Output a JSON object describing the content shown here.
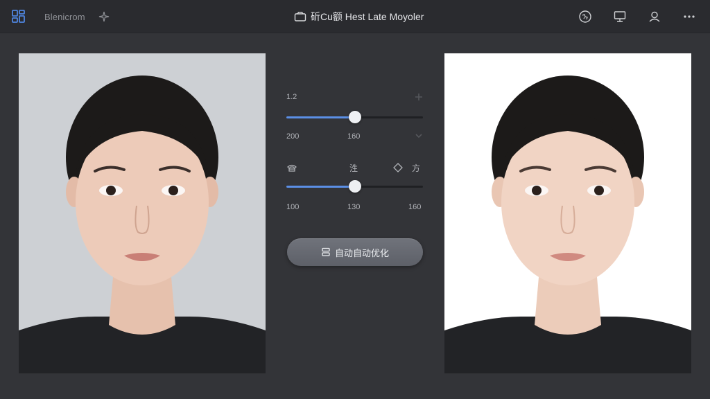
{
  "topbar": {
    "app_name": "Blenicrom",
    "title": "斫Cu额 Hest Late Moyoler",
    "icons": [
      "grid-icon",
      "sparkle-icon",
      "camera-icon",
      "globe-icon",
      "monitor-icon",
      "user-icon",
      "more-icon"
    ]
  },
  "controls": {
    "label_top": "1.2",
    "slider1": {
      "value": 0.5,
      "min_label": "200",
      "mid_label": "160"
    },
    "row2": {
      "mid_label": "泩",
      "right_label": "方"
    },
    "slider2": {
      "value": 0.5,
      "min_label": "100",
      "mid_label": "130",
      "max_label": "160"
    },
    "auto_button_label": "自动自动优化"
  },
  "colors": {
    "accent": "#5b8fe6",
    "background": "#333438",
    "topbar": "#2a2b2f",
    "original_photo_bg": "#cdd0d4",
    "result_photo_bg": "#ffffff"
  }
}
